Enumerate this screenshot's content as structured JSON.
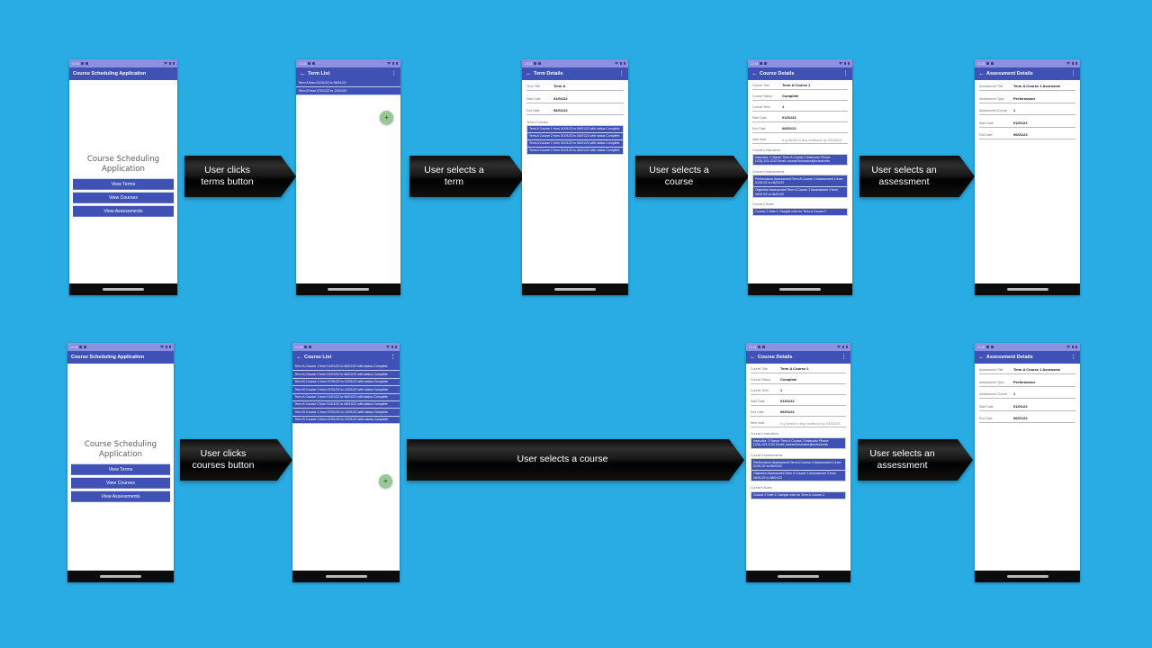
{
  "theme": {
    "background": "#29ace3",
    "app_primary": "#3f51b5",
    "statusbar": "#8d8fe0",
    "fab": "#96c794",
    "arrow": "#0a0a0a"
  },
  "statusbar": {
    "time": "10:34"
  },
  "screens": {
    "home": {
      "appbar_title": "Course Scheduling Application",
      "heading": "Course Scheduling\nApplication",
      "buttons": [
        {
          "label": "View Terms"
        },
        {
          "label": "View Courses"
        },
        {
          "label": "View Assessments"
        }
      ]
    },
    "term_list": {
      "appbar_title": "Term List",
      "items": [
        "Term A from 01/01/22 to 06/01/22",
        "Term B from 07/01/22 to 12/01/22"
      ],
      "fab_label": "+"
    },
    "term_details": {
      "appbar_title": "Term Details",
      "fields": [
        {
          "label": "Term Title",
          "value": "Term A"
        },
        {
          "label": "Start Date",
          "value": "01/01/22"
        },
        {
          "label": "End Date",
          "value": "06/01/22"
        }
      ],
      "section_label": "Term's Courses",
      "courses": [
        "Term A Course 1 from 01/01/22 to 06/01/22 with status Complete",
        "Term A Course 2 from 01/01/22 to 06/01/22 with status Complete",
        "Term A Course 1 from 01/01/22 to 06/01/22 with status Complete",
        "Term A Course 2 from 01/01/22 to 06/01/22 with status Complete"
      ]
    },
    "course_list": {
      "appbar_title": "Course List",
      "items": [
        "Term A Course 1 from 01/01/22 to 06/01/22 with status Complete",
        "Term A Course 2 from 01/01/22 to 06/01/22 with status Complete",
        "Term B Course 1 from 07/01/22 to 12/01/22 with status Complete",
        "Term B Course 2 from 07/01/22 to 12/01/22 with status Complete",
        "Term A Course 1 from 01/01/22 to 06/01/22 with status Complete",
        "Term A Course 2 from 01/01/22 to 06/01/22 with status Complete",
        "Term B Course 1 from 07/01/22 to 12/01/22 with status Complete",
        "Term B Course 2 from 07/01/22 to 12/01/22 with status Complete"
      ],
      "fab_label": "+"
    },
    "course_details": {
      "appbar_title": "Course Details",
      "fields": [
        {
          "label": "Course Title",
          "value": "Term A Course 2"
        },
        {
          "label": "Course Status",
          "value": "Complete"
        },
        {
          "label": "Course Term",
          "value": "1"
        },
        {
          "label": "Start Date",
          "value": "01/01/22"
        },
        {
          "label": "End Date",
          "value": "06/01/22"
        },
        {
          "label": "New Note",
          "value": "e.g Need to buy textbook by 03/03/23"
        }
      ],
      "instructors_label": "Course's Instructors",
      "instructors": [
        "Instructor: 2 Name: Term A Course 2 Instructor Phone: (123)-123-1232 Email: course2instructor@school.edu"
      ],
      "assessments_label": "Course's Assessments",
      "assessments": [
        "Performance Assessment:Term A Course 2 Assessment 1 from 01/01/22 to 06/01/22",
        "Objective Assessment:Term A Course 2 Assessment 3 from 06/01/22 to 06/01/22"
      ],
      "notes_label": "Course's Notes",
      "notes": [
        "Course 2 Note 2: Sample note for Term A Course 2"
      ]
    },
    "assessment_details": {
      "appbar_title": "Assessment Details",
      "fields": [
        {
          "label": "Assessment Title",
          "value": "Term A Course 1 Assessme"
        },
        {
          "label": "Assessment Type",
          "value": "Performance"
        },
        {
          "label": "Assessment Course",
          "value": "1"
        },
        {
          "label": "Start Date",
          "value": "01/01/22"
        },
        {
          "label": "End Date",
          "value": "06/01/22"
        }
      ]
    }
  },
  "arrows": {
    "a1": "User clicks\nterms button",
    "a2": "User selects a\nterm",
    "a3": "User selects a\ncourse",
    "a4": "User selects an\nassessment",
    "b1": "User clicks\ncourses  button",
    "b2": "User selects a course",
    "b3": "User selects an\nassessment"
  },
  "icons": {
    "back": "arrow-left-icon",
    "overflow": "more-vertical-icon",
    "fab_add": "plus-icon"
  }
}
